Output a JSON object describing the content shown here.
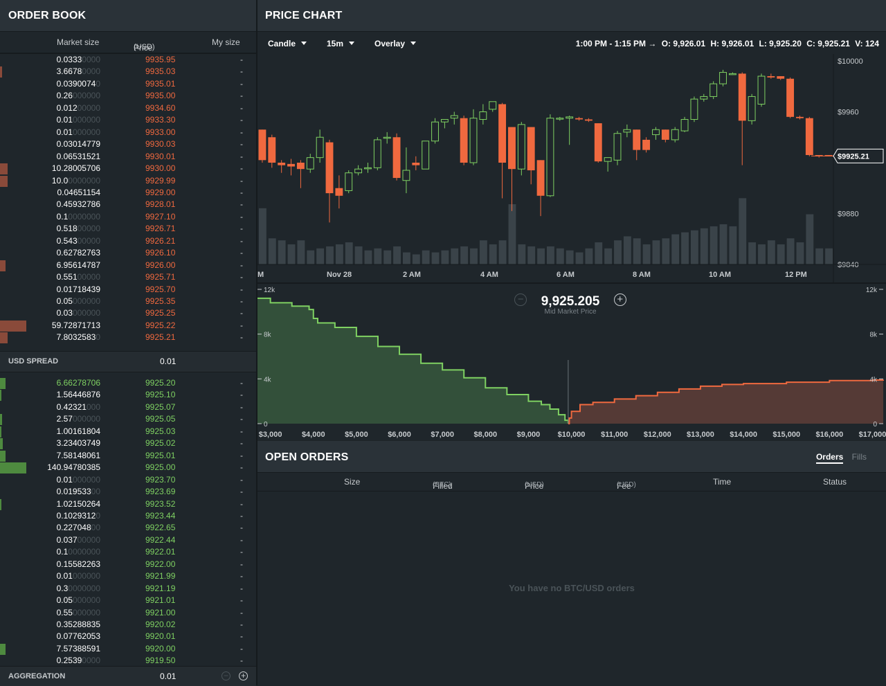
{
  "order_book": {
    "title": "ORDER BOOK",
    "columns": {
      "market_size": "Market size",
      "price": "Price",
      "price_unit": "(USD)",
      "my_size": "My size"
    },
    "asks": [
      {
        "size": "0.0333",
        "faded": "0000",
        "price": "9935.95",
        "mine": "-",
        "bar": 0
      },
      {
        "size": "3.6678",
        "faded": "0000",
        "price": "9935.03",
        "mine": "-",
        "bar": 0.08
      },
      {
        "size": "0.0390074",
        "faded": "0",
        "price": "9935.01",
        "mine": "-",
        "bar": 0
      },
      {
        "size": "0.26",
        "faded": "000000",
        "price": "9935.00",
        "mine": "-",
        "bar": 0
      },
      {
        "size": "0.012",
        "faded": "00000",
        "price": "9934.60",
        "mine": "-",
        "bar": 0
      },
      {
        "size": "0.01",
        "faded": "000000",
        "price": "9933.30",
        "mine": "-",
        "bar": 0
      },
      {
        "size": "0.01",
        "faded": "000000",
        "price": "9933.00",
        "mine": "-",
        "bar": 0
      },
      {
        "size": "0.03014779",
        "faded": "",
        "price": "9930.03",
        "mine": "-",
        "bar": 0
      },
      {
        "size": "0.06531521",
        "faded": "",
        "price": "9930.01",
        "mine": "-",
        "bar": 0
      },
      {
        "size": "10.28005706",
        "faded": "",
        "price": "9930.00",
        "mine": "-",
        "bar": 0.3
      },
      {
        "size": "10.0",
        "faded": "0000000",
        "price": "9929.99",
        "mine": "-",
        "bar": 0.3
      },
      {
        "size": "0.04651154",
        "faded": "",
        "price": "9929.00",
        "mine": "-",
        "bar": 0
      },
      {
        "size": "0.45932786",
        "faded": "",
        "price": "9928.01",
        "mine": "-",
        "bar": 0
      },
      {
        "size": "0.1",
        "faded": "0000000",
        "price": "9927.10",
        "mine": "-",
        "bar": 0
      },
      {
        "size": "0.518",
        "faded": "00000",
        "price": "9926.71",
        "mine": "-",
        "bar": 0
      },
      {
        "size": "0.543",
        "faded": "00000",
        "price": "9926.21",
        "mine": "-",
        "bar": 0
      },
      {
        "size": "0.62782763",
        "faded": "",
        "price": "9926.10",
        "mine": "-",
        "bar": 0
      },
      {
        "size": "6.95614787",
        "faded": "",
        "price": "9926.00",
        "mine": "-",
        "bar": 0.22
      },
      {
        "size": "0.551",
        "faded": "00000",
        "price": "9925.71",
        "mine": "-",
        "bar": 0
      },
      {
        "size": "0.01718439",
        "faded": "",
        "price": "9925.70",
        "mine": "-",
        "bar": 0
      },
      {
        "size": "0.05",
        "faded": "000000",
        "price": "9925.35",
        "mine": "-",
        "bar": 0
      },
      {
        "size": "0.03",
        "faded": "000000",
        "price": "9925.25",
        "mine": "-",
        "bar": 0
      },
      {
        "size": "59.72871713",
        "faded": "",
        "price": "9925.22",
        "mine": "-",
        "bar": 1.0
      },
      {
        "size": "7.8032583",
        "faded": "0",
        "price": "9925.21",
        "mine": "-",
        "bar": 0.28
      }
    ],
    "spread": {
      "label": "USD SPREAD",
      "value": "0.01"
    },
    "bids": [
      {
        "size": "6.66278706",
        "faded": "",
        "price": "9925.20",
        "mine": "-",
        "bar": 0.2,
        "highlight": true
      },
      {
        "size": "1.56446876",
        "faded": "",
        "price": "9925.10",
        "mine": "-",
        "bar": 0.04
      },
      {
        "size": "0.42321",
        "faded": "000",
        "price": "9925.07",
        "mine": "-",
        "bar": 0
      },
      {
        "size": "2.57",
        "faded": "000000",
        "price": "9925.05",
        "mine": "-",
        "bar": 0.08
      },
      {
        "size": "1.00161804",
        "faded": "",
        "price": "9925.03",
        "mine": "-",
        "bar": 0.04
      },
      {
        "size": "3.23403749",
        "faded": "",
        "price": "9925.02",
        "mine": "-",
        "bar": 0.1
      },
      {
        "size": "7.58148061",
        "faded": "",
        "price": "9925.01",
        "mine": "-",
        "bar": 0.22
      },
      {
        "size": "140.94780385",
        "faded": "",
        "price": "9925.00",
        "mine": "-",
        "bar": 1.0
      },
      {
        "size": "0.01",
        "faded": "000000",
        "price": "9923.70",
        "mine": "-",
        "bar": 0
      },
      {
        "size": "0.019533",
        "faded": "00",
        "price": "9923.69",
        "mine": "-",
        "bar": 0
      },
      {
        "size": "1.02150264",
        "faded": "",
        "price": "9923.52",
        "mine": "-",
        "bar": 0.04
      },
      {
        "size": "0.1029312",
        "faded": "0",
        "price": "9923.44",
        "mine": "-",
        "bar": 0
      },
      {
        "size": "0.227048",
        "faded": "00",
        "price": "9922.65",
        "mine": "-",
        "bar": 0
      },
      {
        "size": "0.037",
        "faded": "00000",
        "price": "9922.44",
        "mine": "-",
        "bar": 0
      },
      {
        "size": "0.1",
        "faded": "0000000",
        "price": "9922.01",
        "mine": "-",
        "bar": 0
      },
      {
        "size": "0.15582263",
        "faded": "",
        "price": "9922.00",
        "mine": "-",
        "bar": 0
      },
      {
        "size": "0.01",
        "faded": "000000",
        "price": "9921.99",
        "mine": "-",
        "bar": 0
      },
      {
        "size": "0.3",
        "faded": "0000000",
        "price": "9921.19",
        "mine": "-",
        "bar": 0
      },
      {
        "size": "0.05",
        "faded": "000000",
        "price": "9921.01",
        "mine": "-",
        "bar": 0
      },
      {
        "size": "0.55",
        "faded": "000000",
        "price": "9921.00",
        "mine": "-",
        "bar": 0
      },
      {
        "size": "0.35288835",
        "faded": "",
        "price": "9920.02",
        "mine": "-",
        "bar": 0
      },
      {
        "size": "0.07762053",
        "faded": "",
        "price": "9920.01",
        "mine": "-",
        "bar": 0
      },
      {
        "size": "7.57388591",
        "faded": "",
        "price": "9920.00",
        "mine": "-",
        "bar": 0.22
      },
      {
        "size": "0.2539",
        "faded": "0000",
        "price": "9919.50",
        "mine": "-",
        "bar": 0
      }
    ],
    "aggregation": {
      "label": "AGGREGATION",
      "value": "0.01",
      "minus": "−",
      "plus": "+"
    }
  },
  "price_chart": {
    "title": "PRICE CHART",
    "toolbar": {
      "chart_type": "Candle",
      "interval": "15m",
      "overlay": "Overlay"
    },
    "ohlc": {
      "range": "1:00 PM - 1:15 PM →",
      "open": "O: 9,926.01",
      "high": "H: 9,926.01",
      "low": "L: 9,925.20",
      "close": "C: 9,925.21",
      "volume": "V: 124"
    },
    "current_price_tag": "$9925.21",
    "mid_market": {
      "value": "9,925.205",
      "label": "Mid Market Price",
      "minus": "−",
      "plus": "+"
    }
  },
  "chart_data": [
    {
      "type": "candlestick",
      "y_ticks": [
        "$10000",
        "$9960",
        "$9880",
        "$9840"
      ],
      "x_ticks": [
        "M",
        "Nov 28",
        "2 AM",
        "4 AM",
        "6 AM",
        "8 AM",
        "10 AM",
        "12 PM"
      ],
      "ylim": [
        9840,
        10000
      ],
      "candles": [
        {
          "o": 9946,
          "c": 9922,
          "h": 9946,
          "l": 9920
        },
        {
          "o": 9940,
          "c": 9920,
          "h": 9942,
          "l": 9916
        },
        {
          "o": 9920,
          "c": 9918,
          "h": 9922,
          "l": 9912
        },
        {
          "o": 9919,
          "c": 9917,
          "h": 9923,
          "l": 9910
        },
        {
          "o": 9920,
          "c": 9915,
          "h": 9922,
          "l": 9900
        },
        {
          "o": 9915,
          "c": 9924,
          "h": 9927,
          "l": 9912
        },
        {
          "o": 9924,
          "c": 9940,
          "h": 9946,
          "l": 9920
        },
        {
          "o": 9936,
          "c": 9896,
          "h": 9938,
          "l": 9873
        },
        {
          "o": 9900,
          "c": 9894,
          "h": 9910,
          "l": 9884
        },
        {
          "o": 9898,
          "c": 9912,
          "h": 9914,
          "l": 9896
        },
        {
          "o": 9912,
          "c": 9915,
          "h": 9918,
          "l": 9910
        },
        {
          "o": 9916,
          "c": 9916,
          "h": 9920,
          "l": 9912
        },
        {
          "o": 9916,
          "c": 9938,
          "h": 9940,
          "l": 9914
        },
        {
          "o": 9940,
          "c": 9940,
          "h": 9944,
          "l": 9935
        },
        {
          "o": 9940,
          "c": 9908,
          "h": 9943,
          "l": 9906
        },
        {
          "o": 9906,
          "c": 9914,
          "h": 9932,
          "l": 9896
        },
        {
          "o": 9920,
          "c": 9918,
          "h": 9925,
          "l": 9914
        },
        {
          "o": 9915,
          "c": 9937,
          "h": 9937,
          "l": 9915
        },
        {
          "o": 9937,
          "c": 9952,
          "h": 9955,
          "l": 9935
        },
        {
          "o": 9952,
          "c": 9954,
          "h": 9954,
          "l": 9947
        },
        {
          "o": 9955,
          "c": 9957,
          "h": 9960,
          "l": 9950
        },
        {
          "o": 9955,
          "c": 9920,
          "h": 9957,
          "l": 9918
        },
        {
          "o": 9920,
          "c": 9955,
          "h": 9962,
          "l": 9918
        },
        {
          "o": 9954,
          "c": 9960,
          "h": 9966,
          "l": 9950
        },
        {
          "o": 9962,
          "c": 9968,
          "h": 9968,
          "l": 9960
        },
        {
          "o": 9966,
          "c": 9920,
          "h": 9967,
          "l": 9892
        },
        {
          "o": 9948,
          "c": 9915,
          "h": 9948,
          "l": 9882
        },
        {
          "o": 9915,
          "c": 9950,
          "h": 9952,
          "l": 9910
        },
        {
          "o": 9948,
          "c": 9914,
          "h": 9948,
          "l": 9903
        },
        {
          "o": 9922,
          "c": 9894,
          "h": 9922,
          "l": 9878
        },
        {
          "o": 9894,
          "c": 9955,
          "h": 9958,
          "l": 9893
        },
        {
          "o": 9955,
          "c": 9955,
          "h": 9956,
          "l": 9953
        },
        {
          "o": 9955,
          "c": 9956,
          "h": 9957,
          "l": 9934
        },
        {
          "o": 9955,
          "c": 9954,
          "h": 9956,
          "l": 9953
        },
        {
          "o": 9954,
          "c": 9953,
          "h": 9955,
          "l": 9952
        },
        {
          "o": 9951,
          "c": 9921,
          "h": 9951,
          "l": 9920
        },
        {
          "o": 9921,
          "c": 9924,
          "h": 9924,
          "l": 9913
        },
        {
          "o": 9922,
          "c": 9943,
          "h": 9945,
          "l": 9918
        },
        {
          "o": 9944,
          "c": 9946,
          "h": 9950,
          "l": 9940
        },
        {
          "o": 9946,
          "c": 9930,
          "h": 9946,
          "l": 9922
        },
        {
          "o": 9938,
          "c": 9930,
          "h": 9940,
          "l": 9928
        },
        {
          "o": 9942,
          "c": 9946,
          "h": 9948,
          "l": 9938
        },
        {
          "o": 9946,
          "c": 9938,
          "h": 9946,
          "l": 9936
        },
        {
          "o": 9938,
          "c": 9946,
          "h": 9948,
          "l": 9936
        },
        {
          "o": 9945,
          "c": 9954,
          "h": 9956,
          "l": 9944
        },
        {
          "o": 9954,
          "c": 9970,
          "h": 9972,
          "l": 9952
        },
        {
          "o": 9970,
          "c": 9972,
          "h": 9974,
          "l": 9968
        },
        {
          "o": 9972,
          "c": 9982,
          "h": 9984,
          "l": 9970
        },
        {
          "o": 9982,
          "c": 9991,
          "h": 9993,
          "l": 9980
        },
        {
          "o": 9990,
          "c": 9990,
          "h": 9991,
          "l": 9989
        },
        {
          "o": 9990,
          "c": 9953,
          "h": 9991,
          "l": 9918
        },
        {
          "o": 9953,
          "c": 9972,
          "h": 9974,
          "l": 9950
        },
        {
          "o": 9966,
          "c": 9988,
          "h": 9990,
          "l": 9964
        },
        {
          "o": 9988,
          "c": 9987,
          "h": 9990,
          "l": 9986
        },
        {
          "o": 9988,
          "c": 9986,
          "h": 9988,
          "l": 9985
        },
        {
          "o": 9986,
          "c": 9956,
          "h": 9987,
          "l": 9955
        },
        {
          "o": 9956,
          "c": 9955,
          "h": 9957,
          "l": 9954
        },
        {
          "o": 9955,
          "c": 9926,
          "h": 9956,
          "l": 9925
        },
        {
          "o": 9926,
          "c": 9925,
          "h": 9926,
          "l": 9924
        },
        {
          "o": 9926,
          "c": 9925,
          "h": 9926,
          "l": 9925
        }
      ],
      "volume": [
        0.28,
        0.13,
        0.12,
        0.1,
        0.12,
        0.07,
        0.08,
        0.09,
        0.1,
        0.11,
        0.09,
        0.07,
        0.08,
        0.07,
        0.09,
        0.06,
        0.05,
        0.07,
        0.06,
        0.07,
        0.08,
        0.09,
        0.08,
        0.12,
        0.1,
        0.12,
        0.3,
        0.1,
        0.09,
        0.08,
        0.09,
        0.08,
        0.07,
        0.06,
        0.08,
        0.11,
        0.08,
        0.12,
        0.14,
        0.13,
        0.1,
        0.12,
        0.13,
        0.15,
        0.16,
        0.17,
        0.18,
        0.19,
        0.2,
        0.19,
        0.33,
        0.11,
        0.1,
        0.12,
        0.1,
        0.13,
        0.11,
        0.25,
        0.08,
        0.08
      ]
    },
    {
      "type": "area",
      "title": "",
      "y_ticks": [
        "12k",
        "8k",
        "4k",
        "0"
      ],
      "ylim": [
        0,
        12000
      ],
      "x_ticks": [
        "$3,000",
        "$4,000",
        "$5,000",
        "$6,000",
        "$7,000",
        "$8,000",
        "$9,000",
        "$10,000",
        "$11,000",
        "$12,000",
        "$13,000",
        "$14,000",
        "$15,000",
        "$16,000",
        "$17,000"
      ],
      "xlim": [
        2700,
        17250
      ],
      "series": [
        {
          "side": "bid",
          "x": [
            2700,
            3000,
            3500,
            3900,
            4000,
            4100,
            4500,
            5000,
            5500,
            6000,
            6500,
            7000,
            7500,
            8000,
            8500,
            9000,
            9300,
            9500,
            9700,
            9850,
            9925
          ],
          "y": [
            11200,
            10800,
            10500,
            10200,
            9400,
            9000,
            8600,
            7800,
            6900,
            6200,
            5400,
            4800,
            4100,
            3200,
            2600,
            2000,
            1700,
            1300,
            800,
            300,
            0
          ]
        },
        {
          "side": "ask",
          "x": [
            9925,
            9950,
            10000,
            10200,
            10500,
            11000,
            11500,
            12000,
            12500,
            13000,
            13500,
            14000,
            15000,
            16000,
            17000,
            17250
          ],
          "y": [
            0,
            500,
            1100,
            1700,
            1900,
            2200,
            2500,
            2800,
            3100,
            3350,
            3500,
            3580,
            3700,
            3850,
            3900,
            3920
          ]
        }
      ]
    }
  ],
  "open_orders": {
    "title": "OPEN ORDERS",
    "tabs": {
      "orders": "Orders",
      "fills": "Fills"
    },
    "columns": {
      "size": "Size",
      "filled": "Filled",
      "filled_unit": "(BTC)",
      "price": "Price",
      "price_unit": "(USD)",
      "fee": "Fee",
      "fee_unit": "(USD)",
      "time": "Time",
      "status": "Status"
    },
    "empty_message": "You have no BTC/USD orders"
  },
  "colors": {
    "ask": "#f0693f",
    "bid": "#7fd162",
    "bg": "#1f262b"
  }
}
